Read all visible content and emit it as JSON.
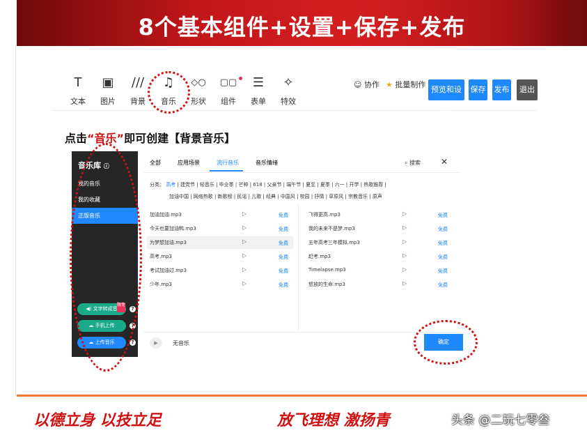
{
  "banner": {
    "title": "8个基本组件+设置+保存+发布"
  },
  "toolbar": {
    "tools": [
      {
        "icon": "T",
        "label": "文本"
      },
      {
        "icon": "▣",
        "label": "图片"
      },
      {
        "icon": "∕∕∕",
        "label": "背景"
      },
      {
        "icon": "♫",
        "label": "音乐"
      },
      {
        "icon": "◇○",
        "label": "形状"
      },
      {
        "icon": "▢▢",
        "label": "组件"
      },
      {
        "icon": "☰",
        "label": "表单"
      },
      {
        "icon": "✧",
        "label": "特效"
      }
    ],
    "collab": "协作",
    "batch": "批量制作",
    "preview_button": "预览和设置",
    "save_button": "保存",
    "publish_button": "发布",
    "exit_button": "退出",
    "accent_color": "#1e88ff"
  },
  "caption": {
    "prefix": "点击",
    "highlight": "“音乐”",
    "suffix": "即可创建【背景音乐】"
  },
  "dialog": {
    "sidebar": {
      "title": "音乐库",
      "items": [
        "我的音乐",
        "我的收藏",
        "正版音乐"
      ],
      "buttons": [
        "文字转成音",
        "手机上传",
        "上传音乐"
      ],
      "badge": "限免"
    },
    "tabs": [
      "全部",
      "应用场景",
      "流行音乐",
      "音乐情绪"
    ],
    "search": "搜索",
    "category_line1": {
      "label": "分类：",
      "active": "高考",
      "rest": "| 建党节 | 轻音乐 | 毕业季 | 芒种 | 618 | 父亲节 | 端午节 | 夏至 | 夏季 | 六一 | 开学 | 热歌推荐 |"
    },
    "category_line2": "加油中国 | 网络热歌 | 新歌榜 | 民谣 | 儿歌 | 经典 | 中国风 | 校园 | 抒情 | 草原风 | 宗教音乐 | 原声",
    "songs_left": [
      "加油加油.mp3",
      "今天也要加油鸭.mp3",
      "为梦想加油.mp3",
      "高考.mp3",
      "考试加油过.mp3",
      "少年.mp3"
    ],
    "songs_right": [
      "飞得更高.mp3",
      "我的未来不是梦.mp3",
      "五年高考三年模拟.mp3",
      "赶考.mp3",
      "Timelapse.mp3",
      "怒放的生命.mp3"
    ],
    "free_label": "免费",
    "play_icon": "▷",
    "no_music": "无音乐",
    "confirm": "确定"
  },
  "footer": {
    "left": "以德立身 以技立足",
    "right": "放飞理想 激扬青",
    "watermark": "头条 @二玩七零叁"
  }
}
